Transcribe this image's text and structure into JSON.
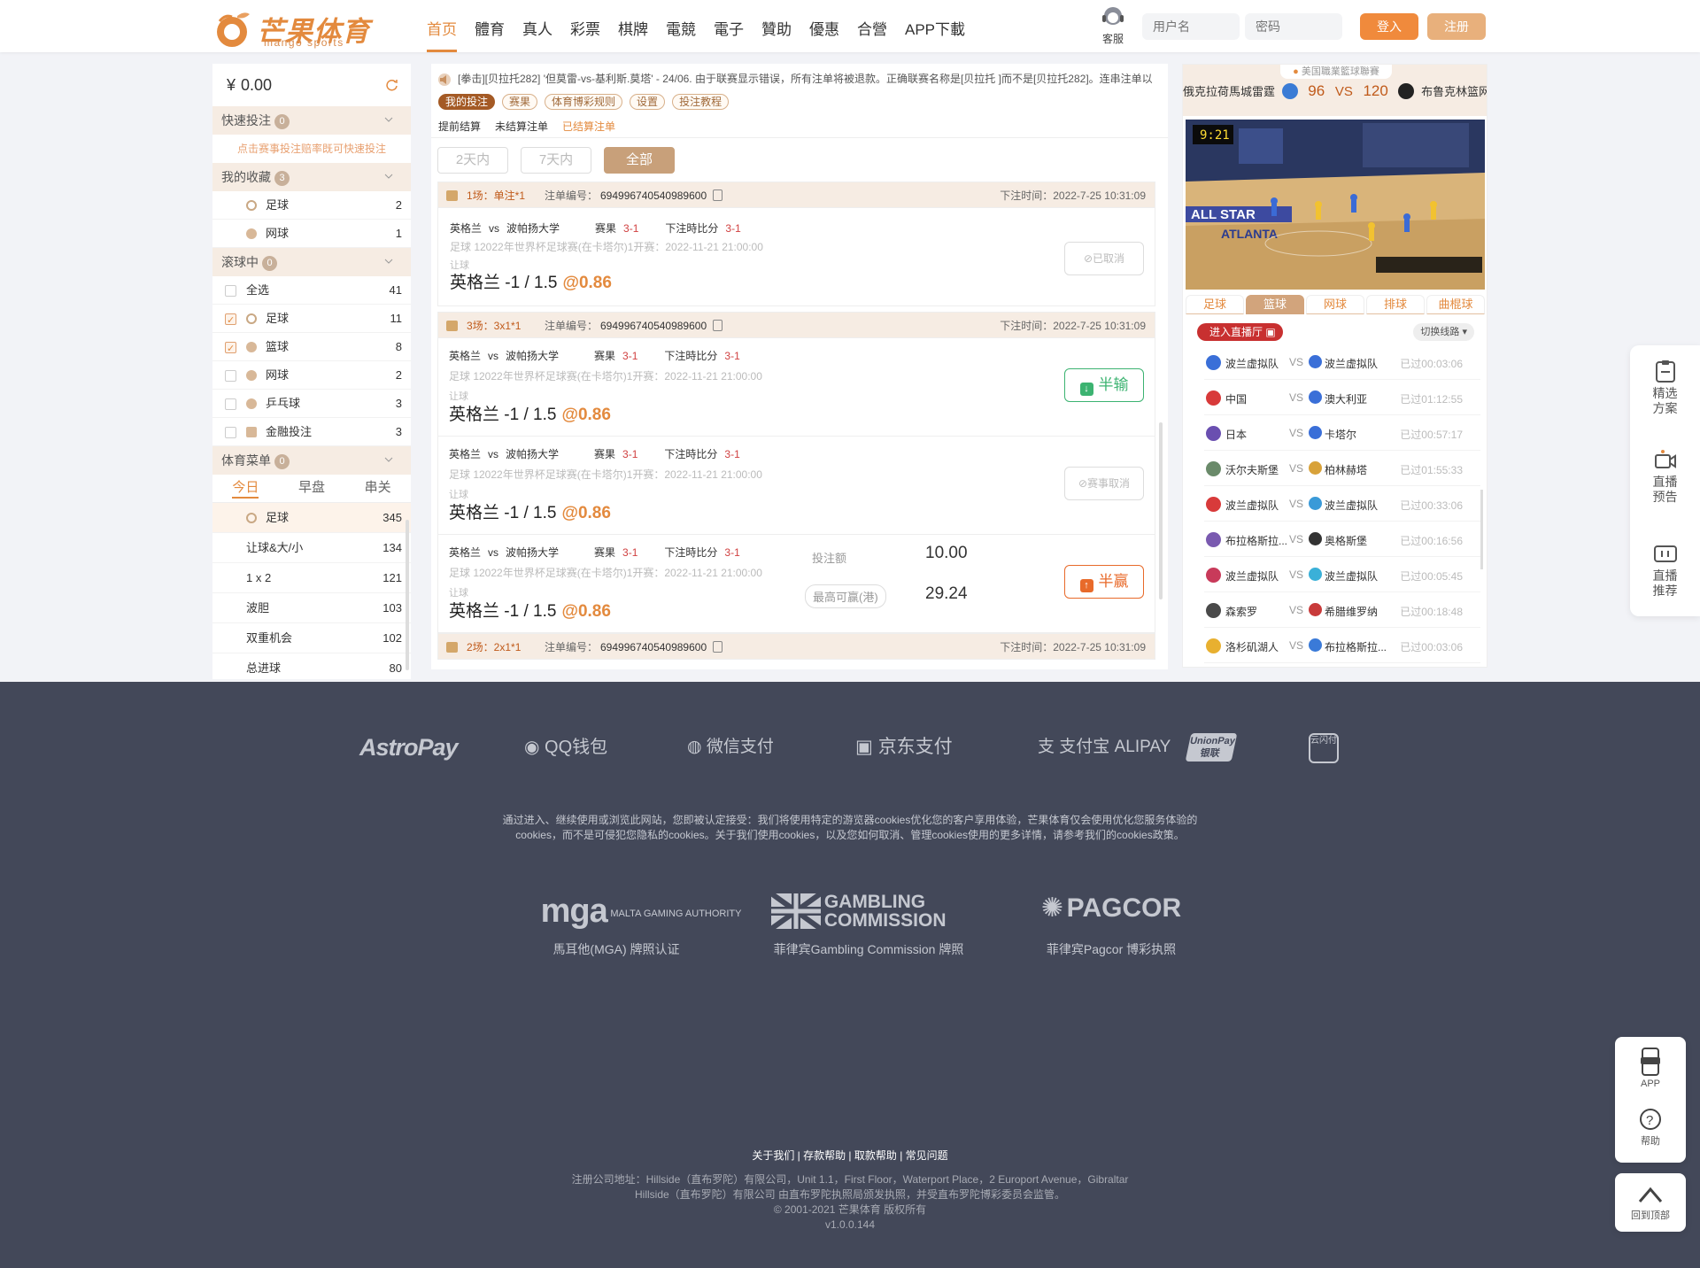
{
  "header": {
    "brand": "芒果体育",
    "brand_sub": "mango sports",
    "nav": [
      "首页",
      "體育",
      "真人",
      "彩票",
      "棋牌",
      "電競",
      "電子",
      "贊助",
      "優惠",
      "合營",
      "APP下載"
    ],
    "support_label": "客服",
    "username_placeholder": "用户名",
    "password_placeholder": "密码",
    "login_label": "登入",
    "register_label": "注册",
    "accent_color": "#e38a3e"
  },
  "sidebar": {
    "currency": "¥",
    "balance": "0.00",
    "quick_bet": {
      "title": "快速投注",
      "count": "0",
      "hint": "点击赛事投注赔率既可快速投注"
    },
    "favorites": {
      "title": "我的收藏",
      "count": "3",
      "items": [
        {
          "label": "足球",
          "count": "2"
        },
        {
          "label": "网球",
          "count": "1"
        }
      ]
    },
    "inplay": {
      "title": "滚球中",
      "count": "0",
      "items": [
        {
          "label": "全选",
          "count": "41",
          "checked": false
        },
        {
          "label": "足球",
          "count": "11",
          "checked": true
        },
        {
          "label": "篮球",
          "count": "8",
          "checked": true
        },
        {
          "label": "网球",
          "count": "2",
          "checked": false
        },
        {
          "label": "乒乓球",
          "count": "3",
          "checked": false
        },
        {
          "label": "金融投注",
          "count": "3",
          "checked": false
        }
      ]
    },
    "sports_menu": {
      "title": "体育菜单",
      "count": "0",
      "tabs": [
        "今日",
        "早盘",
        "串关"
      ],
      "items": [
        {
          "label": "足球",
          "count": "345"
        },
        {
          "label": "让球&大/小",
          "count": "134"
        },
        {
          "label": "1 x 2",
          "count": "121"
        },
        {
          "label": "波胆",
          "count": "103"
        },
        {
          "label": "双重机会",
          "count": "102"
        },
        {
          "label": "总进球",
          "count": "80"
        }
      ]
    }
  },
  "main": {
    "notice": "[拳击][贝拉托282] '但莫雷-vs-基利斯.莫塔' - 24/06. 由于联赛显示错误，所有注单将被退款。正确联赛名称是[贝拉托 ]而不是[贝拉托282]。连串注单以",
    "subtabs": [
      "我的投注",
      "赛果",
      "体育博彩规则",
      "设置",
      "投注教程"
    ],
    "record_tabs": [
      "提前结算",
      "未结算注单",
      "已结算注单"
    ],
    "filters": [
      "2天内",
      "7天内",
      "全部"
    ],
    "bets": [
      {
        "type": "1场：单注*1",
        "no_label": "注单编号：",
        "no": "694996740540989600",
        "time": "下注时间：2022-7-25 10:31:09",
        "legs": [
          {
            "home": "英格兰",
            "vs": "vs",
            "away": "波帕扬大学",
            "result_label": "赛果",
            "result": "3-1",
            "score_label": "下注時比分",
            "score": "3-1",
            "league": "足球 12022年世界杯足球赛(在卡塔尔)1开赛：2022-11-21 21:00:00",
            "market": "让球",
            "pick": "英格兰 -1 / 1.5",
            "odds": "@0.86",
            "status": "已取消"
          }
        ]
      },
      {
        "type": "3场：3x1*1",
        "no_label": "注单编号：",
        "no": "694996740540989600",
        "time": "下注时间：2022-7-25 10:31:09",
        "legs": [
          {
            "home": "英格兰",
            "vs": "vs",
            "away": "波帕扬大学",
            "result_label": "赛果",
            "result": "3-1",
            "score_label": "下注時比分",
            "score": "3-1",
            "league": "足球 12022年世界杯足球赛(在卡塔尔)1开赛：2022-11-21 21:00:00",
            "market": "让球",
            "pick": "英格兰 -1 / 1.5",
            "odds": "@0.86",
            "status": "半输"
          },
          {
            "home": "英格兰",
            "vs": "vs",
            "away": "波帕扬大学",
            "result_label": "赛果",
            "result": "3-1",
            "score_label": "下注時比分",
            "score": "3-1",
            "league": "足球 12022年世界杯足球赛(在卡塔尔)1开赛：2022-11-21 21:00:00",
            "market": "让球",
            "pick": "英格兰 -1 / 1.5",
            "odds": "@0.86",
            "status": "赛事取消"
          },
          {
            "home": "英格兰",
            "vs": "vs",
            "away": "波帕扬大学",
            "result_label": "赛果",
            "result": "3-1",
            "score_label": "下注時比分",
            "score": "3-1",
            "league": "足球 12022年世界杯足球赛(在卡塔尔)1开赛：2022-11-21 21:00:00",
            "market": "让球",
            "pick": "英格兰 -1 / 1.5",
            "odds": "@0.86",
            "status": "半赢",
            "stake_label": "投注额",
            "stake": "10.00",
            "max_win_label": "最高可赢(港)",
            "max_win": "29.24"
          }
        ]
      },
      {
        "type": "2场：2x1*1",
        "no_label": "注单编号：",
        "no": "694996740540989600",
        "time": "下注时间：2022-7-25 10:31:09"
      }
    ]
  },
  "live": {
    "league": "美国職業籃球聯賽",
    "home": "俄克拉荷馬城雷霆",
    "home_score": "96",
    "vs": "VS",
    "away_score": "120",
    "away": "布鲁克林篮网",
    "video_clock": "9:21",
    "video_board": "ALL STAR",
    "video_city": "ATLANTA",
    "sport_tabs": [
      "足球",
      "篮球",
      "网球",
      "排球",
      "曲棍球"
    ],
    "enter_live": "进入直播厅",
    "switch_route": "切换线路",
    "games": [
      {
        "home": "波兰虚拟队",
        "away": "波兰虚拟队",
        "time": "已过00:03:06"
      },
      {
        "home": "中国",
        "away": "澳大利亚",
        "time": "已过01:12:55"
      },
      {
        "home": "日本",
        "away": "卡塔尔",
        "time": "已过00:57:17"
      },
      {
        "home": "沃尔夫斯堡",
        "away": "柏林赫塔",
        "time": "已过01:55:33"
      },
      {
        "home": "波兰虚拟队",
        "away": "波兰虚拟队",
        "time": "已过00:33:06"
      },
      {
        "home": "布拉格斯拉...",
        "away": "奥格斯堡",
        "time": "已过00:16:56"
      },
      {
        "home": "波兰虚拟队",
        "away": "波兰虚拟队",
        "time": "已过00:05:45"
      },
      {
        "home": "森索罗",
        "away": "希腊维罗纳",
        "time": "已过00:18:48"
      },
      {
        "home": "洛杉矶湖人",
        "away": "布拉格斯拉...",
        "time": "已过00:03:06"
      }
    ],
    "vs_label": "VS"
  },
  "side_panel": [
    "精选方案",
    "直播预告",
    "直播推荐"
  ],
  "footer": {
    "payments": [
      "AstroPay",
      "QQ钱包",
      "微信支付",
      "京东支付",
      "支付宝 ALIPAY",
      "UnionPay 银联",
      "云闪付"
    ],
    "cookie_line1": "通过进入、继续使用或浏览此网站，您即被认定接受：我们将使用特定的游览器cookies优化您的客户享用体验，芒果体育仅会使用优化您服务体验的",
    "cookie_line2": "cookies，而不是可侵犯您隐私的cookies。关于我们使用cookies，以及您如何取消、管理cookies使用的更多详情，请参考我们的cookies政策。",
    "licenses": [
      {
        "logo": "mga",
        "logo_sub": "MALTA GAMING AUTHORITY",
        "caption": "馬耳他(MGA) 牌照认证"
      },
      {
        "logo": "GAMBLING COMMISSION",
        "caption": "菲律宾Gambling Commission 牌照"
      },
      {
        "logo": "PAGCOR",
        "caption": "菲律宾Pagcor 博彩执照"
      }
    ],
    "links": "关于我们 | 存款帮助 | 取款帮助 | 常见问题",
    "legal1": "注册公司地址：Hillside（直布罗陀）有限公司，Unit 1.1，First Floor，Waterport Place，2 Europort Avenue，Gibraltar",
    "legal2": "Hillside（直布罗陀）有限公司 由直布罗陀执照局颁发执照，并受直布罗陀博彩委员会监管。",
    "copyright": "© 2001-2021 芒果体育 版权所有",
    "version": "v1.0.0.144",
    "app_label": "APP",
    "help_label": "帮助",
    "top_label": "回到顶部"
  }
}
